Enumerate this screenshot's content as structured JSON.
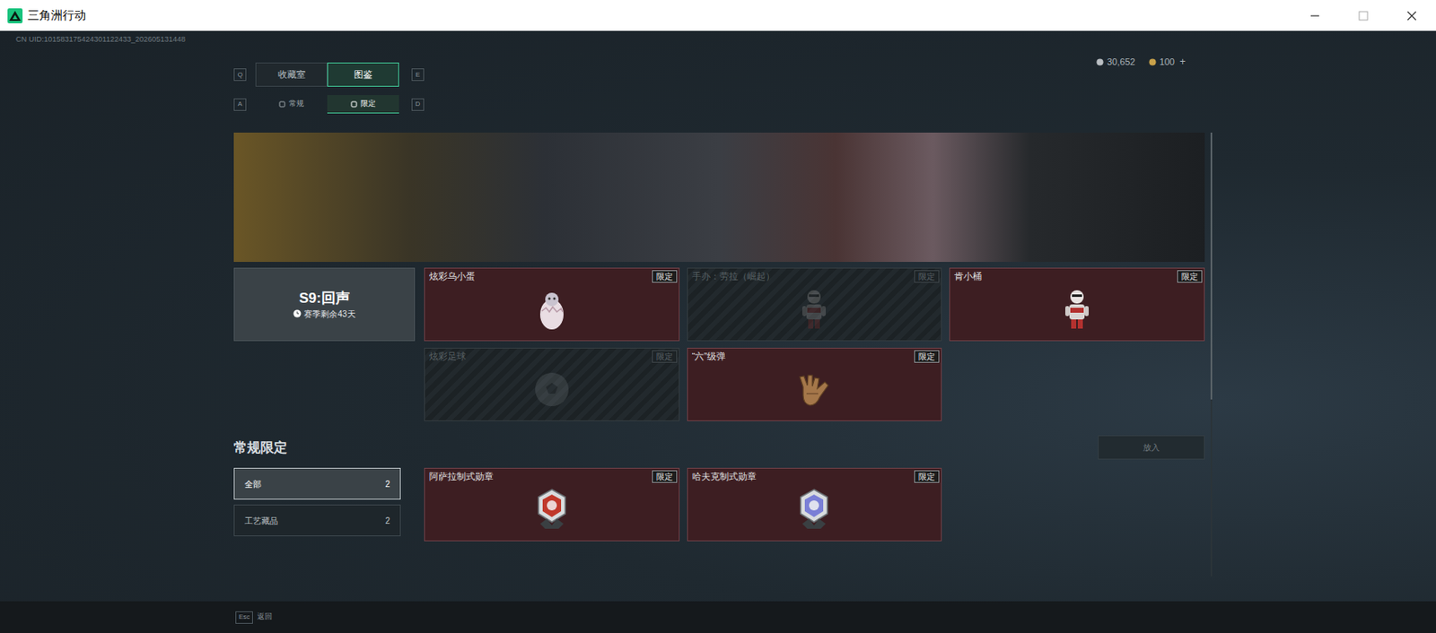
{
  "window": {
    "title": "三角洲行动"
  },
  "uid": "CN UID:101583175424301122433_202605131448",
  "currency": [
    {
      "value": "30,652",
      "color": "#b9bec2"
    },
    {
      "value": "100",
      "color": "#c9a24a"
    }
  ],
  "currency_add": "+",
  "tabs": [
    {
      "label": "收藏室",
      "selected": false
    },
    {
      "label": "图鉴",
      "selected": true
    }
  ],
  "tab_keys": [
    "Q",
    "E"
  ],
  "subtabs": [
    {
      "label": "常规",
      "selected": false
    },
    {
      "label": "限定",
      "selected": true
    }
  ],
  "subtab_keys": [
    "A",
    "D"
  ],
  "season": {
    "title": "S9:回声",
    "remaining": "赛季剩余43天"
  },
  "season_items": [
    {
      "name": "炫彩乌小蛋",
      "badge": "限定",
      "collected": true,
      "kind": "egg"
    },
    {
      "name": "手办：劳拉（崛起）",
      "badge": "限定",
      "collected": false,
      "kind": "figure"
    },
    {
      "name": "肯小桶",
      "badge": "限定",
      "collected": true,
      "kind": "figure"
    },
    {
      "name": "炫彩足球",
      "badge": "限定",
      "collected": false,
      "kind": "ball"
    },
    {
      "name": "“六”级弹",
      "badge": "限定",
      "collected": true,
      "kind": "glove"
    }
  ],
  "section": {
    "title": "常规限定",
    "action": {
      "label": "放入",
      "disabled": true
    }
  },
  "filters": [
    {
      "label": "全部",
      "count": "2",
      "selected": true
    },
    {
      "label": "工艺藏品",
      "count": "2",
      "selected": false
    }
  ],
  "regular_items": [
    {
      "name": "阿萨拉制式勋章",
      "badge": "限定",
      "collected": true,
      "kind": "medal",
      "color": "#c0392b"
    },
    {
      "name": "哈夫克制式勋章",
      "badge": "限定",
      "collected": true,
      "kind": "medal",
      "color": "#7a7fd6"
    }
  ],
  "footer": {
    "key": "Esc",
    "label": "返回"
  }
}
